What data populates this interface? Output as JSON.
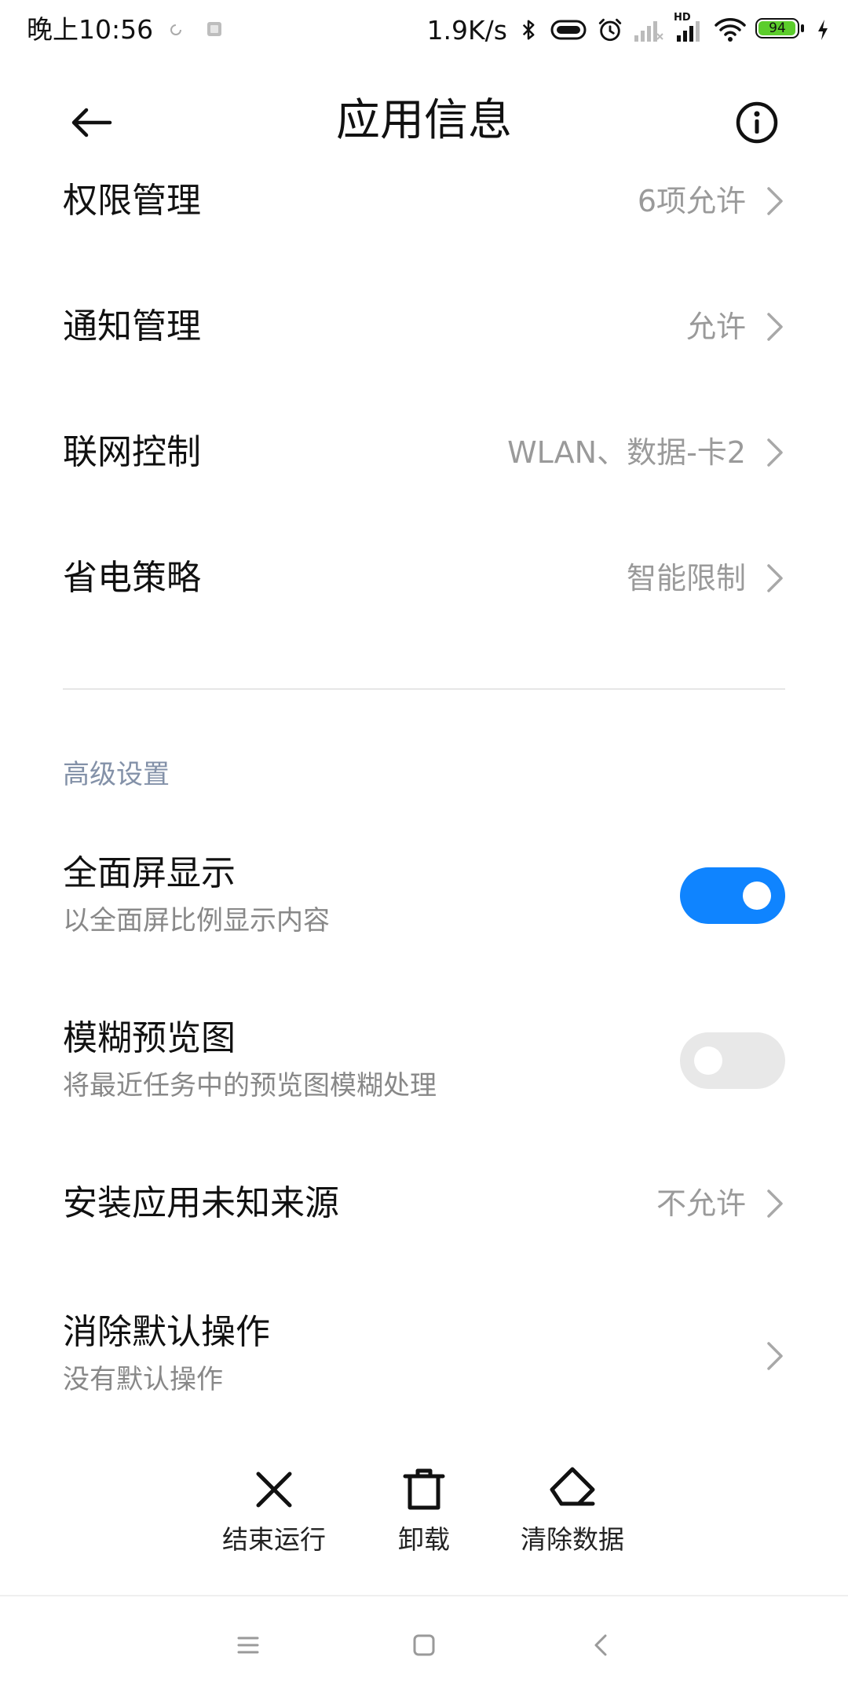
{
  "status_bar": {
    "time": "晚上10:56",
    "network_speed": "1.9K/s",
    "hd_label": "HD",
    "battery_level": "94",
    "icons": [
      "loading-icon",
      "app-notification-icon",
      "bluetooth-icon",
      "vibrate-icon",
      "alarm-icon",
      "signal-sim1-icon",
      "signal-sim2-icon",
      "wifi-icon",
      "battery-icon",
      "charging-icon"
    ]
  },
  "header": {
    "title": "应用信息",
    "back_icon": "back-arrow-icon",
    "info_icon": "info-icon"
  },
  "settings": [
    {
      "title": "权限管理",
      "value": "6项允许"
    },
    {
      "title": "通知管理",
      "value": "允许"
    },
    {
      "title": "联网控制",
      "value": "WLAN、数据-卡2"
    },
    {
      "title": "省电策略",
      "value": "智能限制"
    }
  ],
  "advanced": {
    "section_label": "高级设置",
    "fullscreen": {
      "title": "全面屏显示",
      "subtitle": "以全面屏比例显示内容",
      "enabled": true
    },
    "blur_preview": {
      "title": "模糊预览图",
      "subtitle": "将最近任务中的预览图模糊处理",
      "enabled": false
    },
    "unknown_sources": {
      "title": "安装应用未知来源",
      "value": "不允许"
    },
    "clear_defaults": {
      "title": "消除默认操作",
      "subtitle": "没有默认操作"
    }
  },
  "actions": {
    "force_stop": "结束运行",
    "uninstall": "卸载",
    "clear_data": "清除数据"
  },
  "colors": {
    "accent": "#0f84ff",
    "value_text": "#9a9a9a",
    "section_label": "#8391a8",
    "battery_fill": "#5ccd2c"
  }
}
